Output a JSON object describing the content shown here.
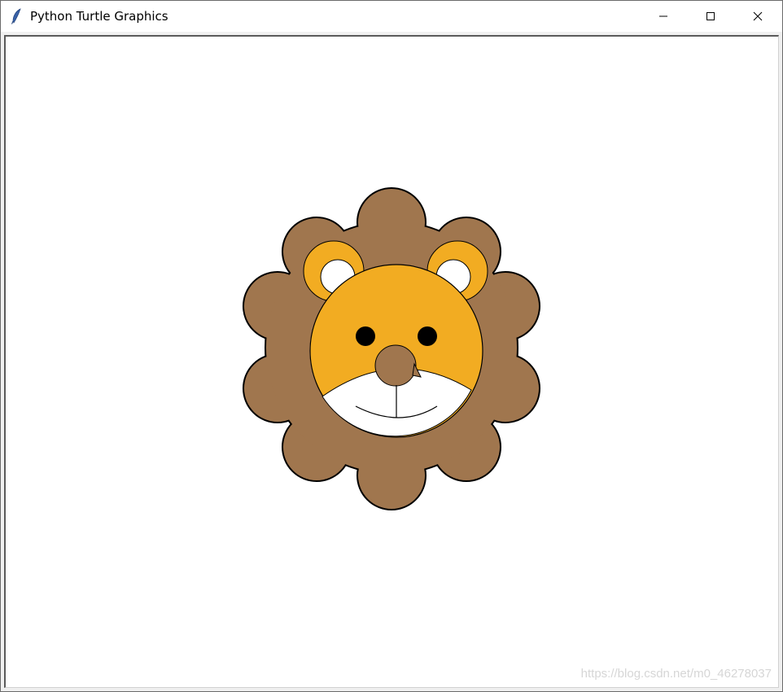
{
  "window": {
    "title": "Python Turtle Graphics",
    "icon": "feather-icon",
    "controls": [
      "minimize-icon",
      "maximize-icon",
      "close-icon"
    ]
  },
  "canvas": {
    "background": "#ffffff",
    "colors": {
      "mane": "#a0764e",
      "face": "#f2ac22",
      "ear_inner": "#ffffff",
      "muzzle": "#ffffff",
      "eyes": "#000000",
      "nose": "#a0764e",
      "outline": "#000000"
    }
  },
  "watermark": "https://blog.csdn.net/m0_46278037"
}
